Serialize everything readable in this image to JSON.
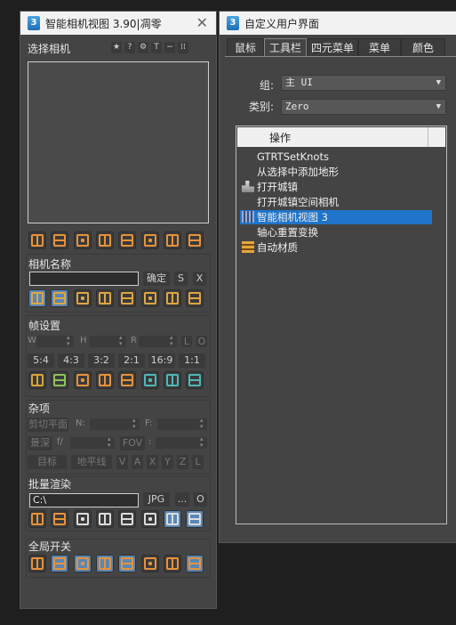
{
  "left_window": {
    "title": "智能相机视图 3.90|凋零",
    "icon_text": "3",
    "select_camera": {
      "label": "选择相机",
      "header_buttons": [
        "★",
        "?",
        "⚙",
        "T",
        "−",
        "⁞⁞"
      ],
      "camera_buttons": [
        {
          "icon": "camera-a-icon",
          "color": "#e8923a"
        },
        {
          "icon": "camera-f-icon",
          "color": "#e8923a"
        },
        {
          "icon": "camera-b-icon",
          "color": "#e8923a"
        },
        {
          "icon": "camera-u-icon",
          "color": "#e8923a"
        },
        {
          "icon": "camera-left-top-icon",
          "color": "#e8923a"
        },
        {
          "icon": "camera-left-bottom-icon",
          "color": "#e8923a"
        },
        {
          "icon": "camera-right-top-icon",
          "color": "#e8923a"
        },
        {
          "icon": "camera-right-bottom-icon",
          "color": "#e8923a"
        }
      ]
    },
    "camera_name": {
      "label": "相机名称",
      "confirm": "确定",
      "s": "S",
      "x": "X",
      "tools": [
        {
          "icon": "align-h-icon",
          "color": "#e0a640",
          "selected": true
        },
        {
          "icon": "align-v-icon",
          "color": "#e0a640",
          "selected": true
        },
        {
          "icon": "center-icon",
          "color": "#e0a640",
          "selected": false
        },
        {
          "icon": "distribute-icon",
          "color": "#e0a640",
          "selected": false
        },
        {
          "icon": "spread-icon",
          "color": "#e0a640",
          "selected": false
        },
        {
          "icon": "align-left-icon",
          "color": "#e0a640",
          "selected": false
        },
        {
          "icon": "align-right-icon",
          "color": "#e0a640",
          "selected": false
        },
        {
          "icon": "align-bottom-icon",
          "color": "#e0a640",
          "selected": false
        }
      ]
    },
    "frame_settings": {
      "label": "帧设置",
      "w": "W",
      "h": "H",
      "r": "R",
      "l": "L",
      "o": "O",
      "ratios": [
        "5:4",
        "4:3",
        "3:2",
        "2:1",
        "16:9",
        "1:1"
      ],
      "tools": [
        {
          "icon": "grid-plus-icon",
          "color": "#d9a43a"
        },
        {
          "icon": "split-icon",
          "color": "#8fc25a"
        },
        {
          "icon": "frame-center-icon",
          "color": "#e8923a"
        },
        {
          "icon": "frame-lines-icon",
          "color": "#e8923a"
        },
        {
          "icon": "frame-cols-icon",
          "color": "#e8923a"
        },
        {
          "icon": "frame-dots-icon",
          "color": "#4fb8b8"
        },
        {
          "icon": "frame-ring-icon",
          "color": "#4fb8b8"
        },
        {
          "icon": "frame-grid-icon",
          "color": "#4fb8b8"
        }
      ]
    },
    "misc": {
      "label": "杂项",
      "clip_plane": "剪切平面",
      "n": "N:",
      "f": "F:",
      "depth": "景深",
      "fstop": "f/",
      "fov": "FOV",
      "colon": ":",
      "target": "目标",
      "horizon": "地平线",
      "axes": [
        "V",
        "A",
        "X",
        "Y",
        "Z",
        "L"
      ]
    },
    "batch_render": {
      "label": "批量渲染",
      "path": "C:\\",
      "format": "JPG",
      "dots": "...",
      "open": "O",
      "tools": [
        {
          "icon": "render-frame-icon",
          "color": "#e8923a",
          "selected": false
        },
        {
          "icon": "render-region-icon",
          "color": "#e8923a",
          "selected": false
        },
        {
          "icon": "render-bottom-icon",
          "color": "#dcdcdc",
          "selected": false
        },
        {
          "icon": "render-window-icon",
          "color": "#dcdcdc",
          "selected": false
        },
        {
          "icon": "render-list-icon",
          "color": "#dcdcdc",
          "selected": false
        },
        {
          "icon": "render-tiles-icon",
          "color": "#dcdcdc",
          "selected": false
        },
        {
          "icon": "render-view-icon",
          "color": "#dcdcdc",
          "selected": true
        },
        {
          "icon": "render-safe-icon",
          "color": "#dcdcdc",
          "selected": true
        }
      ]
    },
    "global_toggles": {
      "label": "全局开关",
      "tools": [
        {
          "icon": "toggle-bar-icon",
          "color": "#e8923a",
          "selected": false
        },
        {
          "icon": "toggle-corners-icon",
          "color": "#e8923a",
          "selected": true
        },
        {
          "icon": "toggle-quad-icon",
          "color": "#e8923a",
          "selected": true
        },
        {
          "icon": "toggle-half-icon",
          "color": "#e8923a",
          "selected": true
        },
        {
          "icon": "toggle-center-icon",
          "color": "#e8923a",
          "selected": true
        },
        {
          "icon": "toggle-dots-icon",
          "color": "#e8923a",
          "selected": false
        },
        {
          "icon": "toggle-cross-icon",
          "color": "#e8923a",
          "selected": false
        },
        {
          "icon": "toggle-grid-icon",
          "color": "#e8923a",
          "selected": true
        }
      ]
    }
  },
  "right_window": {
    "title": "自定义用户界面",
    "icon_text": "3",
    "tabs": [
      "鼠标",
      "工具栏",
      "四元菜单",
      "菜单",
      "颜色"
    ],
    "active_tab": 1,
    "group_label": "组:",
    "group_value": "主 UI",
    "category_label": "类别:",
    "category_value": "Zero",
    "list_header": "操作",
    "actions": [
      {
        "label": "GTRTSetKnots",
        "icon": "",
        "highlighted": false
      },
      {
        "label": "从选择中添加地形",
        "icon": "",
        "highlighted": false
      },
      {
        "label": "打开城镇",
        "icon": "town-icon",
        "highlighted": false
      },
      {
        "label": "打开城镇空间相机",
        "icon": "",
        "highlighted": false
      },
      {
        "label": "智能相机视图 3",
        "icon": "smart-camera-icon",
        "highlighted": true
      },
      {
        "label": "轴心重置变换",
        "icon": "",
        "highlighted": false
      },
      {
        "label": "自动材质",
        "icon": "material-icon",
        "highlighted": false
      }
    ]
  }
}
